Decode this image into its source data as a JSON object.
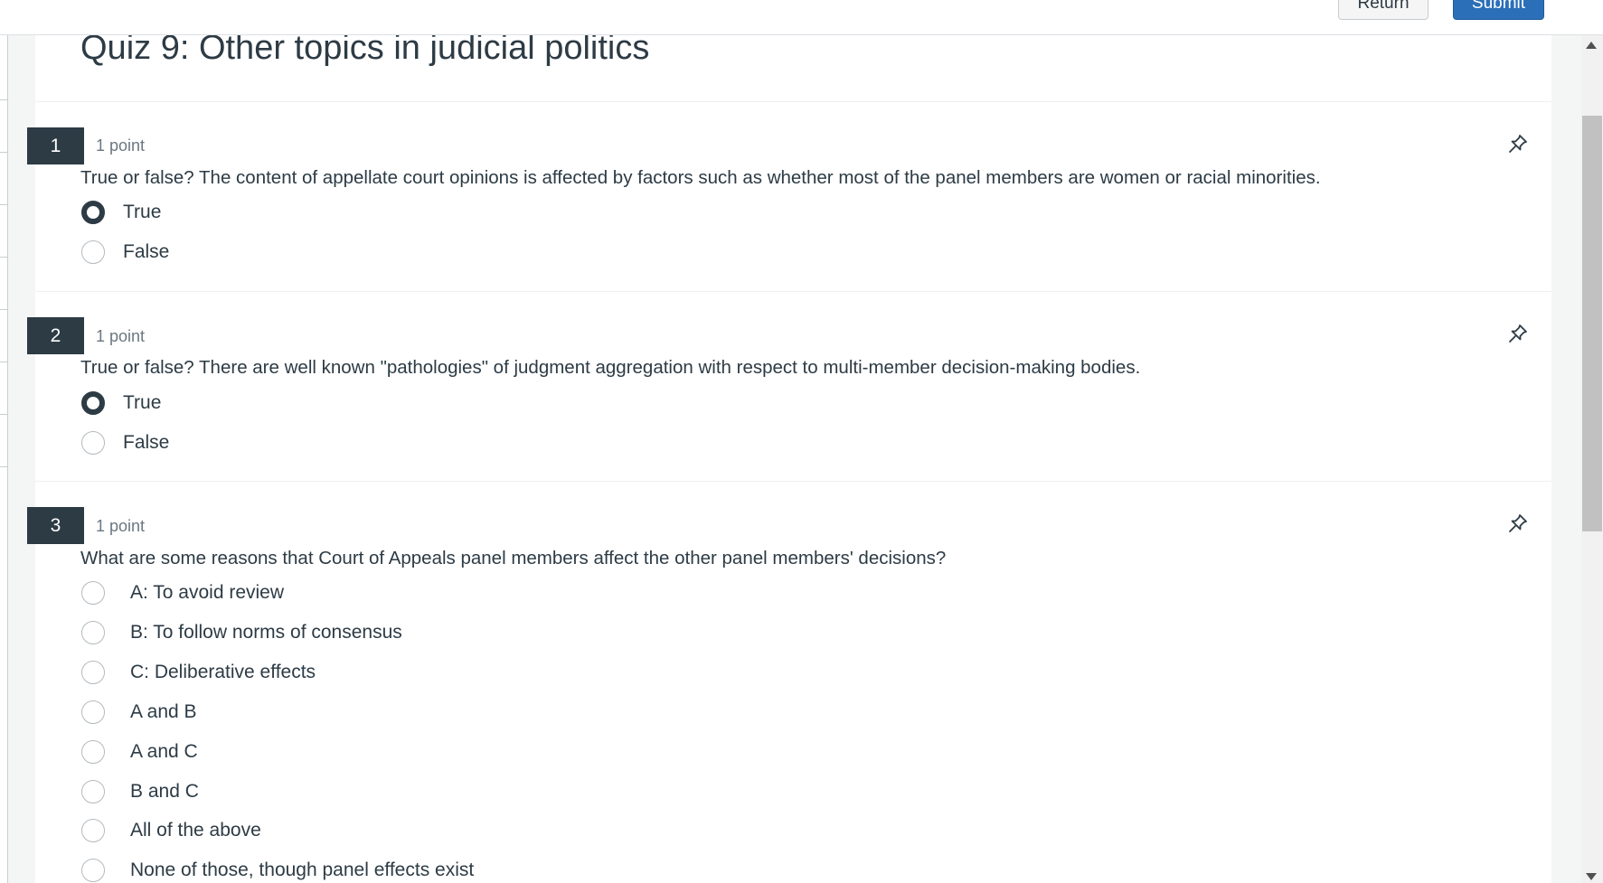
{
  "header": {
    "return_label": "Return",
    "submit_label": "Submit"
  },
  "quiz": {
    "title": "Quiz 9: Other topics in judicial politics"
  },
  "questions": [
    {
      "number": "1",
      "points": "1 point",
      "text": "True or false? The content of appellate court opinions is affected by factors such as whether most of the panel members are women or racial minorities.",
      "selected": "True",
      "options": [
        "True",
        "False"
      ]
    },
    {
      "number": "2",
      "points": "1 point",
      "text": "True or false? There are well known \"pathologies\" of judgment aggregation with respect to multi-member decision-making bodies.",
      "selected": "True",
      "options": [
        "True",
        "False"
      ]
    },
    {
      "number": "3",
      "points": "1 point",
      "text": "What are some reasons that Court of Appeals panel members affect the other panel members' decisions?",
      "selected": null,
      "options": [
        "A: To avoid review",
        "B: To follow norms of consensus",
        "C: Deliberative effects",
        "A and B",
        "A and C",
        "B and C",
        "All of the above",
        "None of those, though panel effects exist"
      ]
    }
  ],
  "icons": {
    "pin": "pin-icon",
    "scroll_up": "chevron-up-icon",
    "scroll_down": "chevron-down-icon"
  },
  "colors": {
    "accent": "#2d3b45",
    "submit": "#2b6fb8",
    "text": "#2d3b45",
    "muted": "#6b7780"
  }
}
